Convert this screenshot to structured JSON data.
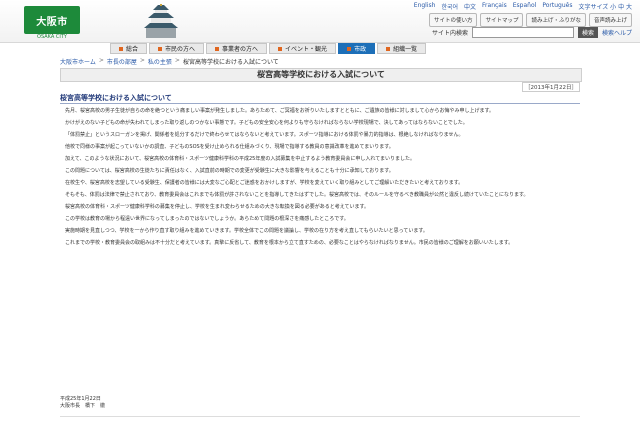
{
  "logo": {
    "text": "大阪市",
    "sub": "OSAKA CITY"
  },
  "languages": [
    "English",
    "한국어",
    "中文",
    "Français",
    "Español",
    "Português",
    "文字サイズ 小 中 大"
  ],
  "utility_buttons": [
    "サイトの使い方",
    "サイトマップ",
    "読み上げ・ふりがな",
    "音声読み上げ"
  ],
  "search": {
    "label": "サイト内検索",
    "placeholder": "",
    "button": "検索",
    "help": "検索ヘルプ"
  },
  "nav": [
    {
      "label": "総合",
      "active": false
    },
    {
      "label": "市民の方へ",
      "active": false
    },
    {
      "label": "事業者の方へ",
      "active": false
    },
    {
      "label": "イベント・観光",
      "active": false
    },
    {
      "label": "市政",
      "active": true
    },
    {
      "label": "組織一覧",
      "active": false
    }
  ],
  "breadcrumb": [
    "大阪市ホーム",
    "市長の部屋",
    "私の主張",
    "桜宮高等学校における入試について"
  ],
  "page_title": "桜宮高等学校における入試について",
  "date": "［2013年1月22日］",
  "section_title": "桜宮高等学校における入試について",
  "paragraphs": [
    "先月、桜宮高校の男子生徒が自らの命を絶つという痛ましい事案が発生しました。あらためて、ご冥福をお祈りいたしますとともに、ご遺族の皆様に対しまして心からお悔やみ申し上げます。",
    "かけがえのない子どもの命が失われてしまった取り返しのつかない事態です。子どもの安全安心を何よりも守らなければならない学校現場で、決してあってはならないことでした。",
    "「体罰禁止」というスローガンを掲げ、関係者を処分するだけで終わらせてはならないと考えています。スポーツ指導における体罰や暴力的指導は、根絶しなければなりません。",
    "他校で同様の事案が起こっていないかの調査、子どものSOSを受け止められる仕組みづくり、現場で指導する教員の意識改革を進めてまいります。",
    "加えて、このような状況において、桜宮高校の体育科・スポーツ健康科学科の平成25年度の入試募集を中止するよう教育委員会に申し入れてまいりました。",
    "この問題については、桜宮高校の生徒たちに責任はなく、入試直前の時期での変更が受験生に大きな影響を与えることも十分に承知しております。",
    "在校生や、桜宮高校を志望している受験生、保護者の皆様には大変なご心配とご迷惑をおかけしますが、学校を変えていく取り組みとしてご理解いただきたいと考えております。",
    "そもそも、体罰は法律で禁止されており、教育委員会はこれまでも体罰が許されないことを指導してきたはずでした。桜宮高校では、そのルールを守るべき教職員が公然と違反し続けていたことになります。",
    "桜宮高校の体育科・スポーツ健康科学科の募集を停止し、学校を生まれ変わらせるための大きな転換を図る必要があると考えています。",
    "この学校は教育の場から程遠い世界になってしまったのではないでしょうか。あらためて問題の根深さを痛感したところです。",
    "実施時期を見直しつつ、学校を一から作り直す取り組みを進めていきます。学校全体でこの問題を議論し、学校の在り方を考え直してもらいたいと思っています。",
    "これまでの学校・教育委員会の取組みは不十分だと考えています。真摯に反省して、教育を根本から立て直すための、必要なことはやらなければなりません。市民の皆様のご理解をお願いいたします。"
  ],
  "sign": {
    "date": "平成25年1月22日",
    "name": "大阪市長　橋下　徹"
  }
}
